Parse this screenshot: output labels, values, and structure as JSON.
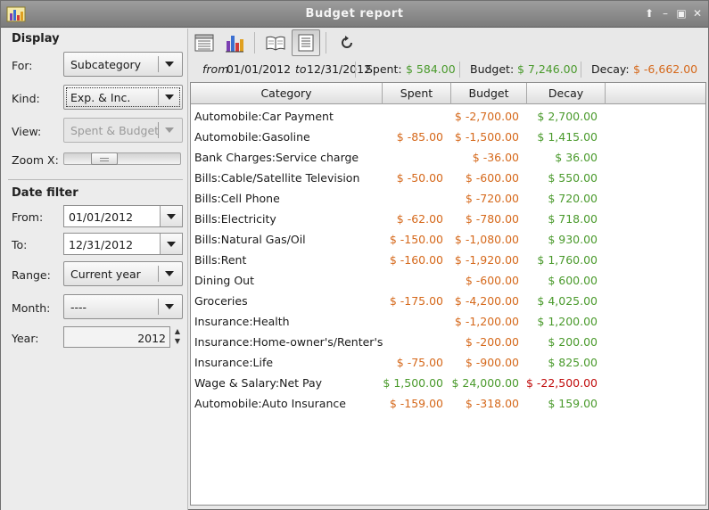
{
  "window": {
    "title": "Budget report"
  },
  "sidebar": {
    "display_title": "Display",
    "for_label": "For:",
    "for_value": "Subcategory",
    "kind_label": "Kind:",
    "kind_value": "Exp. & Inc.",
    "view_label": "View:",
    "view_value": "Spent & Budget",
    "zoom_label": "Zoom X:",
    "date_filter_title": "Date filter",
    "from_label": "From:",
    "from_value": "01/01/2012",
    "to_label": "To:",
    "to_value": "12/31/2012",
    "range_label": "Range:",
    "range_value": "Current year",
    "month_label": "Month:",
    "month_value": "----",
    "year_label": "Year:",
    "year_value": "2012"
  },
  "summary": {
    "from_word": "from",
    "from_date": "01/01/2012",
    "to_word": "to",
    "to_date": "12/31/2012",
    "spent_label": "Spent:",
    "spent_value": "$ 584.00",
    "budget_label": "Budget:",
    "budget_value": "$ 7,246.00",
    "decay_label": "Decay:",
    "decay_value": "$ -6,662.00"
  },
  "table": {
    "columns": [
      "Category",
      "Spent",
      "Budget",
      "Decay"
    ],
    "rows": [
      {
        "category": "Automobile:Car Payment",
        "spent": "",
        "budget": "$ -2,700.00",
        "decay": "$ 2,700.00"
      },
      {
        "category": "Automobile:Gasoline",
        "spent": "$ -85.00",
        "budget": "$ -1,500.00",
        "decay": "$ 1,415.00"
      },
      {
        "category": "Bank Charges:Service charge",
        "spent": "",
        "budget": "$ -36.00",
        "decay": "$ 36.00"
      },
      {
        "category": "Bills:Cable/Satellite Television",
        "spent": "$ -50.00",
        "budget": "$ -600.00",
        "decay": "$ 550.00"
      },
      {
        "category": "Bills:Cell Phone",
        "spent": "",
        "budget": "$ -720.00",
        "decay": "$ 720.00"
      },
      {
        "category": "Bills:Electricity",
        "spent": "$ -62.00",
        "budget": "$ -780.00",
        "decay": "$ 718.00"
      },
      {
        "category": "Bills:Natural Gas/Oil",
        "spent": "$ -150.00",
        "budget": "$ -1,080.00",
        "decay": "$ 930.00"
      },
      {
        "category": "Bills:Rent",
        "spent": "$ -160.00",
        "budget": "$ -1,920.00",
        "decay": "$ 1,760.00"
      },
      {
        "category": "Dining Out",
        "spent": "",
        "budget": "$ -600.00",
        "decay": "$ 600.00"
      },
      {
        "category": "Groceries",
        "spent": "$ -175.00",
        "budget": "$ -4,200.00",
        "decay": "$ 4,025.00"
      },
      {
        "category": "Insurance:Health",
        "spent": "",
        "budget": "$ -1,200.00",
        "decay": "$ 1,200.00"
      },
      {
        "category": "Insurance:Home-owner's/Renter's",
        "spent": "",
        "budget": "$ -200.00",
        "decay": "$ 200.00"
      },
      {
        "category": "Insurance:Life",
        "spent": "$ -75.00",
        "budget": "$ -900.00",
        "decay": "$ 825.00"
      },
      {
        "category": "Wage & Salary:Net Pay",
        "spent": "$ 1,500.00",
        "budget": "$ 24,000.00",
        "decay": "$ -22,500.00"
      },
      {
        "category": "Automobile:Auto Insurance",
        "spent": "$ -159.00",
        "budget": "$ -318.00",
        "decay": "$ 159.00"
      }
    ]
  },
  "colors": {
    "positive": "#4a9a2c",
    "negative": "#d5681a",
    "alert": "#c10d0d"
  },
  "icons": [
    "app-chart-icon",
    "list-view-icon",
    "bar-chart-icon",
    "book-icon",
    "detail-list-icon",
    "refresh-icon"
  ]
}
